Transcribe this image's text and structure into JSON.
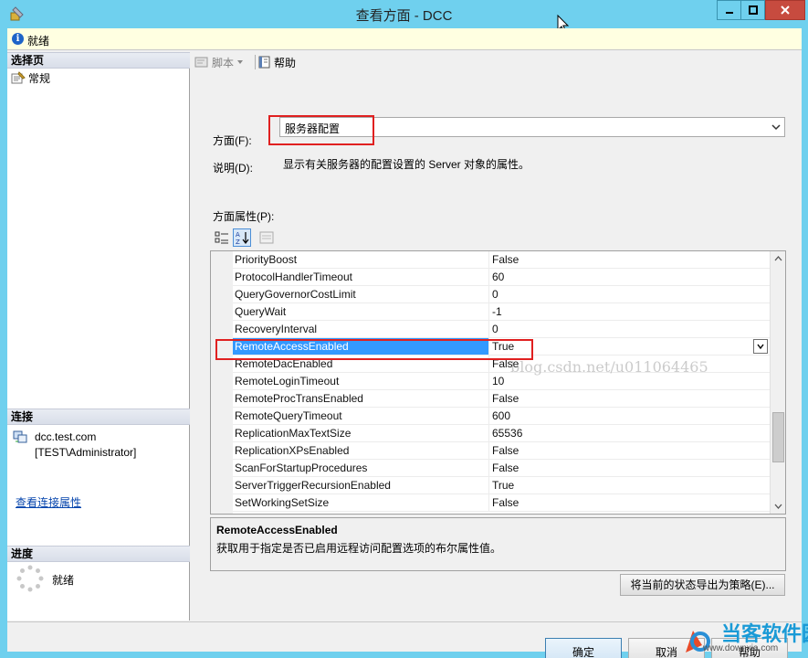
{
  "window": {
    "title": "查看方面 - DCC"
  },
  "infobar": {
    "status": "就绪"
  },
  "left": {
    "select_page_header": "选择页",
    "nav_general": "常规",
    "connection_header": "连接",
    "server": "dcc.test.com",
    "user": "[TEST\\Administrator]",
    "view_connection_link": "查看连接属性",
    "progress_header": "进度",
    "progress_status": "就绪"
  },
  "toolbar": {
    "script_label": "脚本",
    "help_label": "帮助"
  },
  "form": {
    "facet_label": "方面(F):",
    "facet_value": "服务器配置",
    "desc_label": "说明(D):",
    "desc_text": "显示有关服务器的配置设置的 Server 对象的属性。",
    "props_label": "方面属性(P):"
  },
  "properties": [
    {
      "name": "PriorityBoost",
      "value": "False"
    },
    {
      "name": "ProtocolHandlerTimeout",
      "value": "60"
    },
    {
      "name": "QueryGovernorCostLimit",
      "value": "0"
    },
    {
      "name": "QueryWait",
      "value": "-1"
    },
    {
      "name": "RecoveryInterval",
      "value": "0"
    },
    {
      "name": "RemoteAccessEnabled",
      "value": "True"
    },
    {
      "name": "RemoteDacEnabled",
      "value": "False"
    },
    {
      "name": "RemoteLoginTimeout",
      "value": "10"
    },
    {
      "name": "RemoteProcTransEnabled",
      "value": "False"
    },
    {
      "name": "RemoteQueryTimeout",
      "value": "600"
    },
    {
      "name": "ReplicationMaxTextSize",
      "value": "65536"
    },
    {
      "name": "ReplicationXPsEnabled",
      "value": "False"
    },
    {
      "name": "ScanForStartupProcedures",
      "value": "False"
    },
    {
      "name": "ServerTriggerRecursionEnabled",
      "value": "True"
    },
    {
      "name": "SetWorkingSetSize",
      "value": "False"
    }
  ],
  "selected_property": {
    "title": "RemoteAccessEnabled",
    "description": "获取用于指定是否已启用远程访问配置选项的布尔属性值。"
  },
  "watermark": "blog.csdn.net/u011064465",
  "buttons": {
    "export": "将当前的状态导出为策略(E)...",
    "ok": "确定",
    "cancel": "取消",
    "help": "帮助"
  },
  "logo": {
    "text": "当客软件园",
    "sub": "www.downxia.com"
  },
  "colors": {
    "titlebar": "#6fd0ee",
    "selection": "#3399ff",
    "highlight_box": "#e02020",
    "close_button": "#c74b3f"
  }
}
